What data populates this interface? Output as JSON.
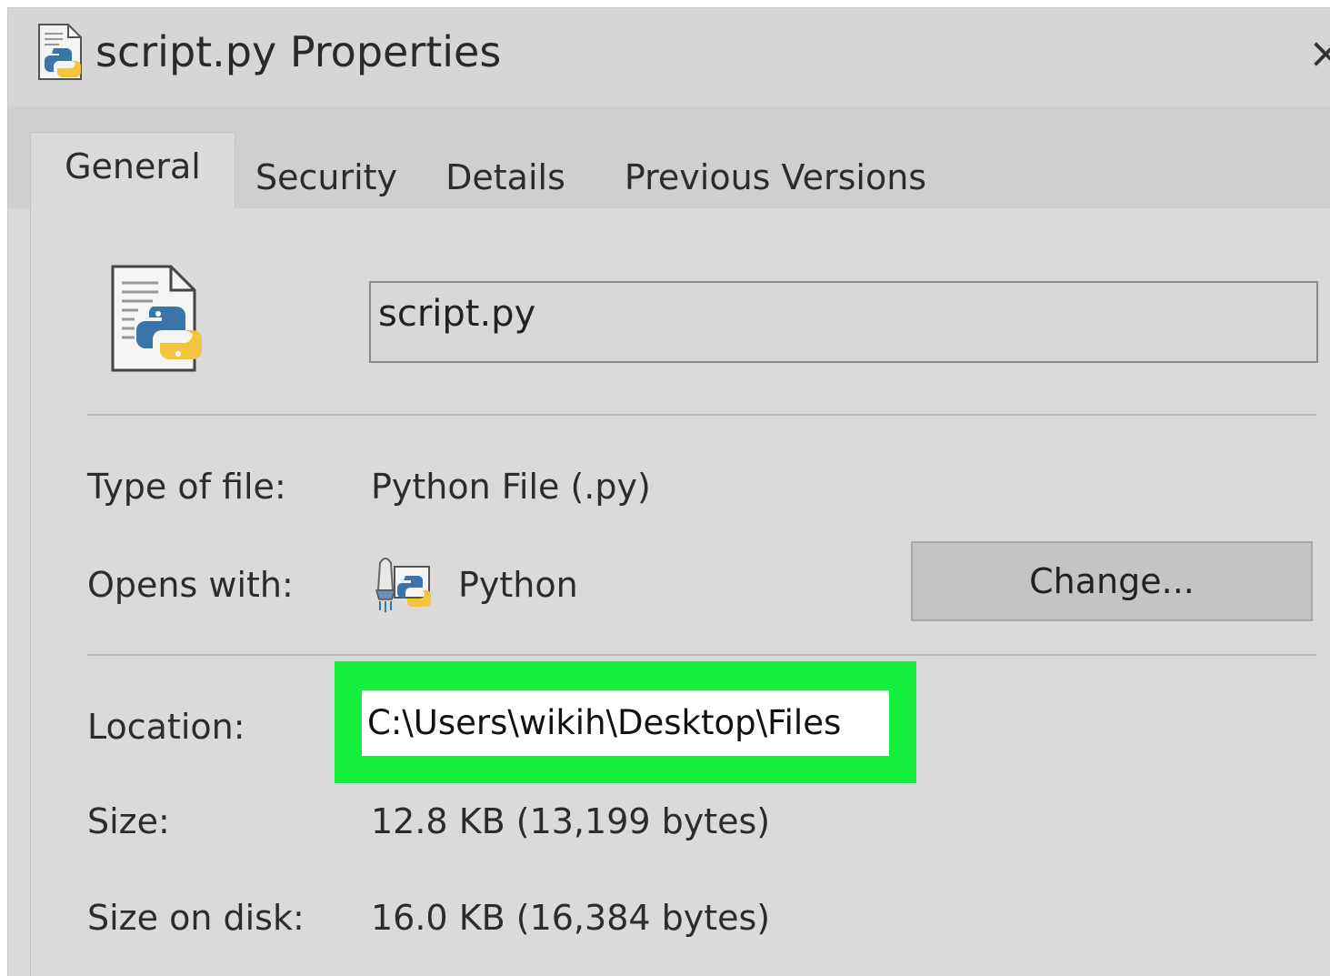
{
  "window": {
    "title": "script.py Properties",
    "close_glyph": "×"
  },
  "tabs": [
    {
      "label": "General",
      "active": true
    },
    {
      "label": "Security",
      "active": false
    },
    {
      "label": "Details",
      "active": false
    },
    {
      "label": "Previous Versions",
      "active": false
    }
  ],
  "general": {
    "file_name": "script.py",
    "type_label": "Type of file:",
    "type_value": "Python File (.py)",
    "opens_label": "Opens with:",
    "opens_value": "Python",
    "change_button": "Change...",
    "location_label": "Location:",
    "location_value": "C:\\Users\\wikih\\Desktop\\Files",
    "size_label": "Size:",
    "size_value": "12.8 KB (13,199 bytes)",
    "disk_label": "Size on disk:",
    "disk_value": "16.0 KB (16,384 bytes)"
  },
  "icons": {
    "title": "python-file-icon",
    "file": "python-file-icon",
    "app": "python-launcher-icon",
    "close": "close-icon"
  },
  "colors": {
    "highlight": "#14ef3e",
    "python_blue": "#3a74a8",
    "python_yellow": "#f2c53c"
  }
}
